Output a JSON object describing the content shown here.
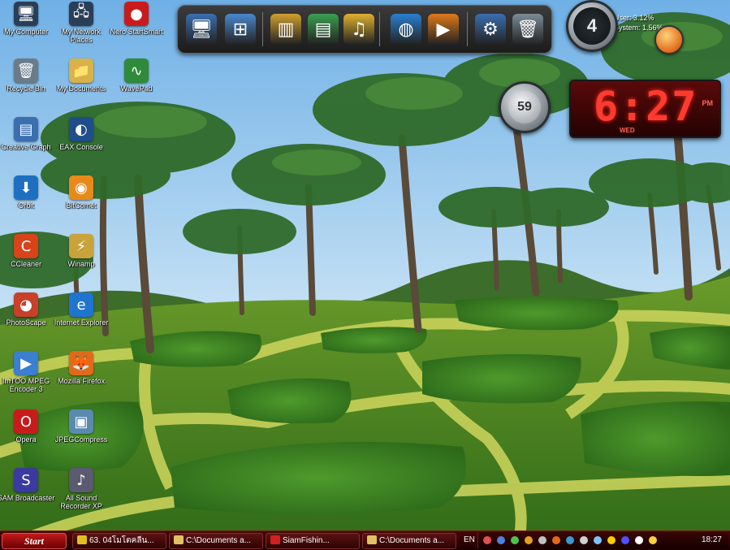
{
  "desktop_icons": [
    {
      "label": "My Computer",
      "icon": "computer-icon",
      "color": "#2a3e58",
      "glyph": "🖥"
    },
    {
      "label": "My Network Places",
      "icon": "network-places-icon",
      "color": "#2a3e58",
      "glyph": "🖧"
    },
    {
      "label": "Nero StartSmart",
      "icon": "nero-icon",
      "color": "#c81c1c",
      "glyph": "●"
    },
    {
      "label": "Recycle Bin",
      "icon": "recycle-bin-icon",
      "color": "#6a7c8a",
      "glyph": "🗑"
    },
    {
      "label": "My Documents",
      "icon": "documents-icon",
      "color": "#d7b24a",
      "glyph": "📁"
    },
    {
      "label": "WavePad",
      "icon": "wavepad-icon",
      "color": "#2f8a3a",
      "glyph": "∿"
    },
    {
      "label": "Creative Graph",
      "icon": "creative-icon",
      "color": "#3a6fb0",
      "glyph": "▤"
    },
    {
      "label": "EAX Console",
      "icon": "eax-icon",
      "color": "#1f4f8a",
      "glyph": "◐"
    },
    {
      "label": "Orbit",
      "icon": "orbit-icon",
      "color": "#1f6fc0",
      "glyph": "⬇"
    },
    {
      "label": "BitComet",
      "icon": "bitcomet-icon",
      "color": "#e88a1a",
      "glyph": "◉"
    },
    {
      "label": "CCleaner",
      "icon": "ccleaner-icon",
      "color": "#d8431a",
      "glyph": "C"
    },
    {
      "label": "Winamp",
      "icon": "winamp-icon",
      "color": "#c8a23a",
      "glyph": "⚡"
    },
    {
      "label": "PhotoScape",
      "icon": "photoscape-icon",
      "color": "#c8402a",
      "glyph": "◕"
    },
    {
      "label": "Internet Explorer",
      "icon": "internet-explorer-icon",
      "color": "#1f74d0",
      "glyph": "e"
    },
    {
      "label": "ImTOO MPEG Encoder 3",
      "icon": "imtoo-icon",
      "color": "#3a7fd0",
      "glyph": "▶"
    },
    {
      "label": "Mozilla Firefox",
      "icon": "firefox-icon",
      "color": "#e06a1a",
      "glyph": "🦊"
    },
    {
      "label": "Opera",
      "icon": "opera-icon",
      "color": "#c81c1c",
      "glyph": "O"
    },
    {
      "label": "JPEGCompress",
      "icon": "jpegcompress-icon",
      "color": "#5a8ab0",
      "glyph": "▣"
    },
    {
      "label": "SAM Broadcaster",
      "icon": "sam-broadcaster-icon",
      "color": "#3a3aa0",
      "glyph": "S"
    },
    {
      "label": "All Sound Recorder XP",
      "icon": "sound-recorder-icon",
      "color": "#5a5a70",
      "glyph": "♪"
    }
  ],
  "dock_items": [
    {
      "name": "dock-computer",
      "icon": "computer-icon",
      "color": "#3a6fb0",
      "glyph": "🖥"
    },
    {
      "name": "dock-windows",
      "icon": "windows-icon",
      "color": "#4a88d0",
      "glyph": "⊞"
    },
    {
      "name": "dock-library",
      "icon": "library-icon",
      "color": "#d0a030",
      "glyph": "▥"
    },
    {
      "name": "dock-documents",
      "icon": "documents-icon",
      "color": "#3aa050",
      "glyph": "▤"
    },
    {
      "name": "dock-music-folder",
      "icon": "music-folder-icon",
      "color": "#e0b030",
      "glyph": "♫"
    },
    {
      "name": "dock-browser",
      "icon": "globe-icon",
      "color": "#2a7fd0",
      "glyph": "◍"
    },
    {
      "name": "dock-media-player",
      "icon": "media-player-icon",
      "color": "#e07a1a",
      "glyph": "▶"
    },
    {
      "name": "dock-settings",
      "icon": "gear-icon",
      "color": "#3a6fb0",
      "glyph": "⚙"
    },
    {
      "name": "dock-recycle-bin",
      "icon": "recycle-bin-icon",
      "color": "#7a8c98",
      "glyph": "🗑"
    }
  ],
  "gadgets": {
    "cpu_gauge_value": "4",
    "seconds_gauge_value": "59",
    "system_info": {
      "user": "User: 3.12%",
      "system": "System: 1.56%"
    },
    "clock": {
      "time": "6:27",
      "ampm": "PM",
      "day": "WED"
    }
  },
  "taskbar": {
    "start_label": "Start",
    "tasks": [
      {
        "label": "63. 04โมโตคลีน...",
        "color": "#e0c020"
      },
      {
        "label": "C:\\Documents a...",
        "color": "#e0c060"
      },
      {
        "label": "SiamFishin...",
        "color": "#d02020"
      },
      {
        "label": "C:\\Documents a...",
        "color": "#e0c060"
      }
    ],
    "language": "EN",
    "clock": "18:27"
  },
  "colors": {
    "taskbar": "#3a0505",
    "accent_red": "#ff3b30",
    "sky": "#8ec6ee",
    "grass": "#3f8a22"
  }
}
